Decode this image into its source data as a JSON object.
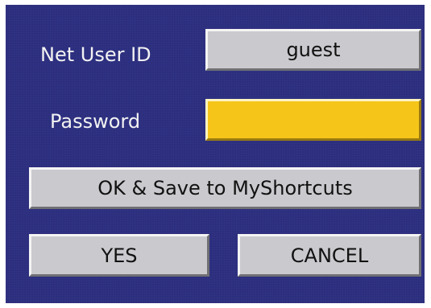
{
  "login_dialog": {
    "user_id_label": "Net User ID",
    "user_id_value": "guest",
    "password_label": "Password",
    "password_value": "",
    "ok_save_label": "OK & Save to MyShortcuts",
    "yes_label": "YES",
    "cancel_label": "CANCEL"
  },
  "colors": {
    "panel_background": "#2b2d7e",
    "field_background": "#c9c9ce",
    "focused_field_background": "#f5c51a",
    "label_text": "#f2f2f2"
  }
}
